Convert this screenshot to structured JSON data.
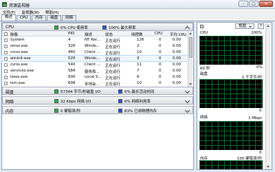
{
  "window": {
    "title": "资源监视器",
    "controls": {
      "min": "–",
      "max": "□",
      "close": "✕"
    }
  },
  "menu": [
    "文件(F)",
    "监视器(M)",
    "帮助(H)"
  ],
  "tabs": [
    "概述",
    "CPU",
    "内存",
    "磁盘",
    "网络"
  ],
  "sections": {
    "cpu": {
      "title": "CPU",
      "ind1": "0% CPU 使用率",
      "ind2": "100% 最大频率"
    },
    "disk": {
      "title": "磁盘",
      "ind1": "57344 字节/秒磁盘 I/O",
      "ind2": "0% 最长活动时间"
    },
    "network": {
      "title": "网络",
      "ind1": "32 Kbps 网络 I/O",
      "ind2": "0% 网络利用率"
    },
    "memory": {
      "title": "内存",
      "ind1": "0 硬错误/秒",
      "ind2": "83% 已用物理内存"
    }
  },
  "cpu_table": {
    "headers": [
      "映像",
      "PID",
      "描述",
      "状态",
      "线程数",
      "CPU",
      "平均 CPU"
    ],
    "rows": [
      [
        "System",
        "4",
        "NT Ker...",
        "正在运行",
        "126",
        "0",
        "0.00"
      ],
      [
        "smss.exe",
        "320",
        "Windo...",
        "正在运行",
        "2",
        "0",
        "0.00"
      ],
      [
        "csrss.exe",
        "460",
        "Client ...",
        "正在运行",
        "10",
        "0",
        "0.00"
      ],
      [
        "wininit.exe",
        "520",
        "Windo...",
        "正在运行",
        "3",
        "0",
        "0.00"
      ],
      [
        "csrss.exe",
        "540",
        "Client ...",
        "正在运行",
        "11",
        "0",
        "0.00"
      ],
      [
        "services.exe",
        "584",
        "服务和...",
        "正在运行",
        "7",
        "0",
        "0.00"
      ],
      [
        "lsass.exe",
        "600",
        "Local S...",
        "正在运行",
        "6",
        "0",
        "0.00"
      ],
      [
        "lsm.exe",
        "608",
        "本地会...",
        "正在运行",
        "10",
        "0",
        "0.00"
      ]
    ]
  },
  "right_panel": {
    "view_label": "视图",
    "help": "?",
    "graphs": [
      {
        "label": "CPU",
        "value": "100%",
        "footer_left": "60 秒",
        "footer_right": "0%"
      },
      {
        "label": "磁盘",
        "value": "1 千字节/秒",
        "footer_right": "0"
      },
      {
        "label": "网络",
        "value": "1 Mbps",
        "footer_right": "0"
      },
      {
        "label": "内存",
        "value": "100 硬错误/秒",
        "footer_right": ""
      }
    ]
  },
  "colors": {
    "green": "#22b14c",
    "blue": "#2a4fd8",
    "graph_bg": "#000000",
    "grid": "#0b6b2e"
  }
}
